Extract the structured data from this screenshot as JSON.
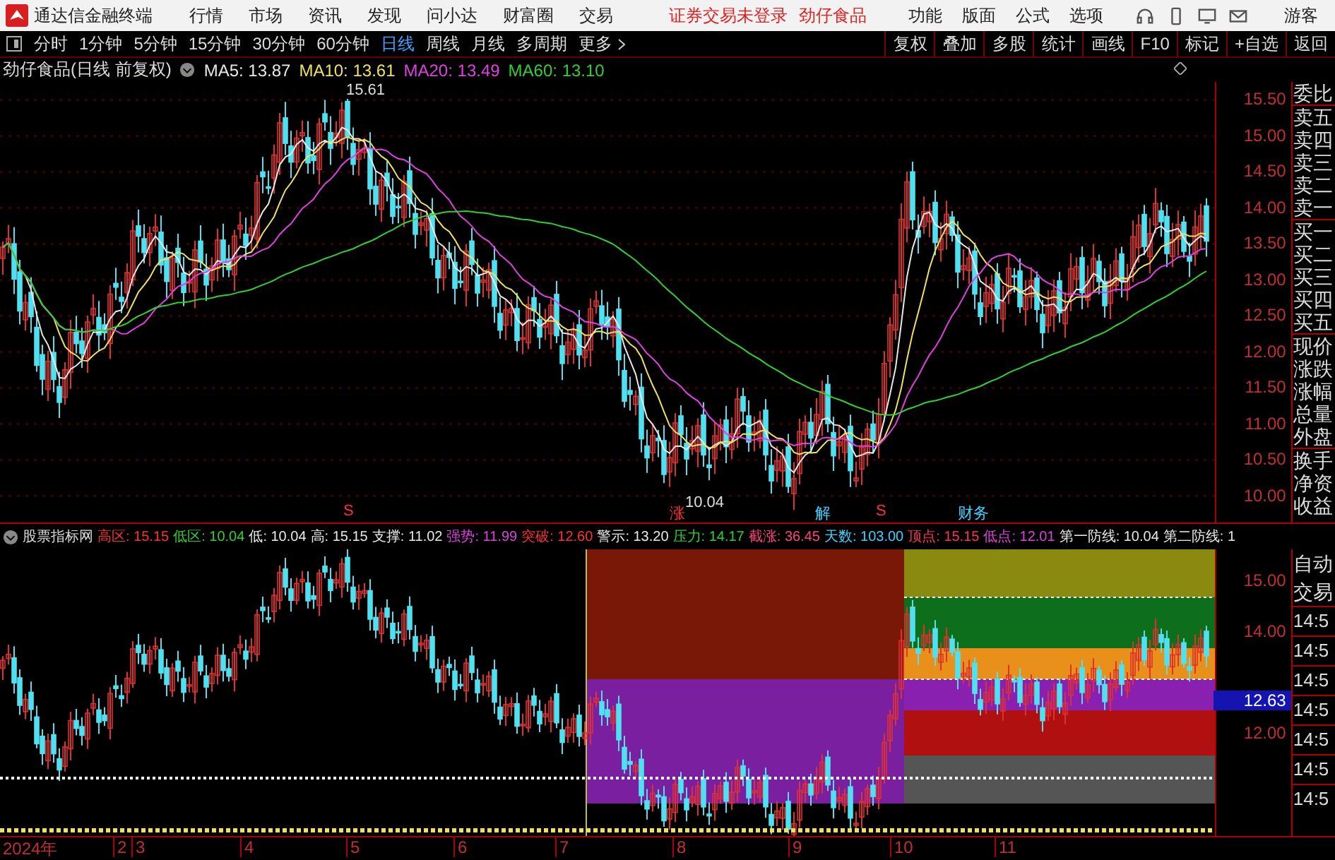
{
  "title_bar": {
    "app_name": "通达信金融终端",
    "menu": [
      "行情",
      "市场",
      "资讯",
      "发现",
      "问小达",
      "财富圈",
      "交易"
    ],
    "notices": [
      "证券交易未登录",
      "劲仔食品"
    ],
    "right_menu": [
      "功能",
      "版面",
      "公式",
      "选项"
    ],
    "user": "游客"
  },
  "toolbar": {
    "periods": [
      {
        "label": "分时",
        "selected": false
      },
      {
        "label": "1分钟",
        "selected": false
      },
      {
        "label": "5分钟",
        "selected": false
      },
      {
        "label": "15分钟",
        "selected": false
      },
      {
        "label": "30分钟",
        "selected": false
      },
      {
        "label": "60分钟",
        "selected": false
      },
      {
        "label": "日线",
        "selected": true
      },
      {
        "label": "周线",
        "selected": false
      },
      {
        "label": "月线",
        "selected": false
      },
      {
        "label": "多周期",
        "selected": false
      }
    ],
    "more": "更多",
    "buttons": [
      "复权",
      "叠加",
      "多股",
      "统计",
      "画线",
      "F10",
      "标记",
      "+自选",
      "返回"
    ]
  },
  "main_chart": {
    "title": "劲仔食品(日线 前复权)",
    "moving_averages": [
      {
        "label": "MA5: 13.87",
        "color": "#e8e8e8"
      },
      {
        "label": "MA10: 13.61",
        "color": "#f0e060"
      },
      {
        "label": "MA20: 13.49",
        "color": "#e040e0"
      },
      {
        "label": "MA60: 13.10",
        "color": "#30d030"
      }
    ],
    "high_label": "15.61",
    "low_label": "10.04",
    "signals": [
      {
        "text": "S",
        "color": "#ff3030"
      },
      {
        "text": "涨",
        "color": "#ff3030"
      },
      {
        "text": "解",
        "color": "#40d0ff"
      },
      {
        "text": "S",
        "color": "#ff3030"
      },
      {
        "text": "财务",
        "color": "#40d0ff"
      }
    ],
    "price_axis": [
      "15.50",
      "15.00",
      "14.50",
      "14.00",
      "13.50",
      "13.00",
      "12.50",
      "12.00",
      "11.50",
      "11.00",
      "10.50",
      "10.00"
    ],
    "side_labels": [
      "委比",
      "卖五",
      "卖四",
      "卖三",
      "卖二",
      "卖一",
      "买一",
      "买二",
      "买三",
      "买四",
      "买五",
      "现价",
      "涨跌",
      "涨幅",
      "总量",
      "外盘",
      "换手",
      "净资",
      "收益"
    ]
  },
  "indicator": {
    "name": "股票指标网",
    "values": [
      {
        "label": "高区:",
        "value": "15.15",
        "color": "#ff3030"
      },
      {
        "label": "低区:",
        "value": "10.04",
        "color": "#30d030"
      },
      {
        "label": "低:",
        "value": "10.04",
        "color": "#e8e8e8"
      },
      {
        "label": "高:",
        "value": "15.15",
        "color": "#e8e8e8"
      },
      {
        "label": "支撑:",
        "value": "11.02",
        "color": "#e8e8e8"
      },
      {
        "label": "强势:",
        "value": "11.99",
        "color": "#e040e0"
      },
      {
        "label": "突破:",
        "value": "12.60",
        "color": "#ff3030"
      },
      {
        "label": "警示:",
        "value": "13.20",
        "color": "#e8e8e8"
      },
      {
        "label": "压力:",
        "value": "14.17",
        "color": "#30d030"
      },
      {
        "label": "截涨:",
        "value": "36.45",
        "color": "#ff4080"
      },
      {
        "label": "天数:",
        "value": "103.00",
        "color": "#40d0ff"
      },
      {
        "label": "顶点:",
        "value": "15.15",
        "color": "#ff3060"
      },
      {
        "label": "低点:",
        "value": "12.01",
        "color": "#e040e0"
      },
      {
        "label": "第一防线:",
        "value": "10.04",
        "color": "#e8e8e8"
      },
      {
        "label": "第二防线:",
        "value": "1",
        "color": "#e8e8e8"
      }
    ],
    "price_axis": [
      {
        "label": "15.00",
        "selected": false
      },
      {
        "label": "14.00",
        "selected": false
      },
      {
        "label": "12.63",
        "selected": true
      },
      {
        "label": "12.00",
        "selected": false
      }
    ],
    "side_labels": [
      "自动",
      "交易",
      "14:5",
      "14:5",
      "14:5",
      "14:5",
      "14:5",
      "14:5",
      "14:5"
    ]
  },
  "date_axis": [
    "2024年",
    "2",
    "3",
    "4",
    "5",
    "6",
    "7",
    "8",
    "9",
    "10",
    "11"
  ]
}
